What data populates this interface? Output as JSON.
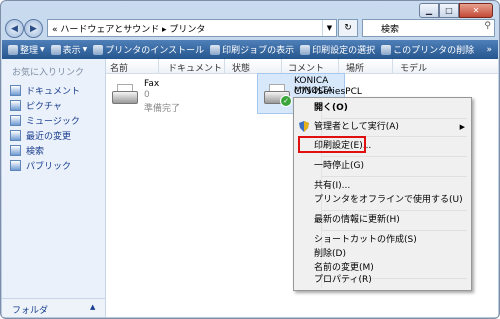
{
  "window": {
    "caption_buttons": {
      "minimize": "▁",
      "maximize": "□",
      "close": "✕"
    }
  },
  "address": {
    "path": "« ハードウェアとサウンド ▸ プリンタ",
    "search_placeholder": "検索"
  },
  "toolbar": {
    "organize": "整理",
    "views": "表示",
    "add_printer": "プリンタのインストール",
    "see_print_queue": "印刷ジョブの表示",
    "select_print_prefs": "印刷設定の選択",
    "delete_printer": "このプリンタの削除",
    "more": "»"
  },
  "nav": {
    "favorites_heading": "お気に入りリンク",
    "items": [
      {
        "label": "ドキュメント"
      },
      {
        "label": "ピクチャ"
      },
      {
        "label": "ミュージック"
      },
      {
        "label": "最近の変更"
      },
      {
        "label": "検索"
      },
      {
        "label": "パブリック"
      }
    ],
    "folders": "フォルダ"
  },
  "columns": [
    "名前",
    "ドキュメント",
    "状態",
    "コメント",
    "場所",
    "モデル"
  ],
  "printers": [
    {
      "name": "Fax",
      "docs": "0",
      "status": "準備完了"
    },
    {
      "name_line1": "KONICA MINOLTA",
      "name_line2": "C754SeriesPCL"
    }
  ],
  "context_menu": {
    "open": "開く(O)",
    "run_as_admin": "管理者として実行(A)",
    "printing_prefs": "印刷設定(E)...",
    "pause": "一時停止(G)",
    "sharing": "共有(I)...",
    "use_offline": "プリンタをオフラインで使用する(U)",
    "refresh": "最新の情報に更新(H)",
    "create_shortcut": "ショートカットの作成(S)",
    "delete": "削除(D)",
    "rename": "名前の変更(M)",
    "properties": "プロパティ(R)"
  },
  "colors": {
    "highlight": "#e01010",
    "toolbar": "#2f5f99"
  }
}
